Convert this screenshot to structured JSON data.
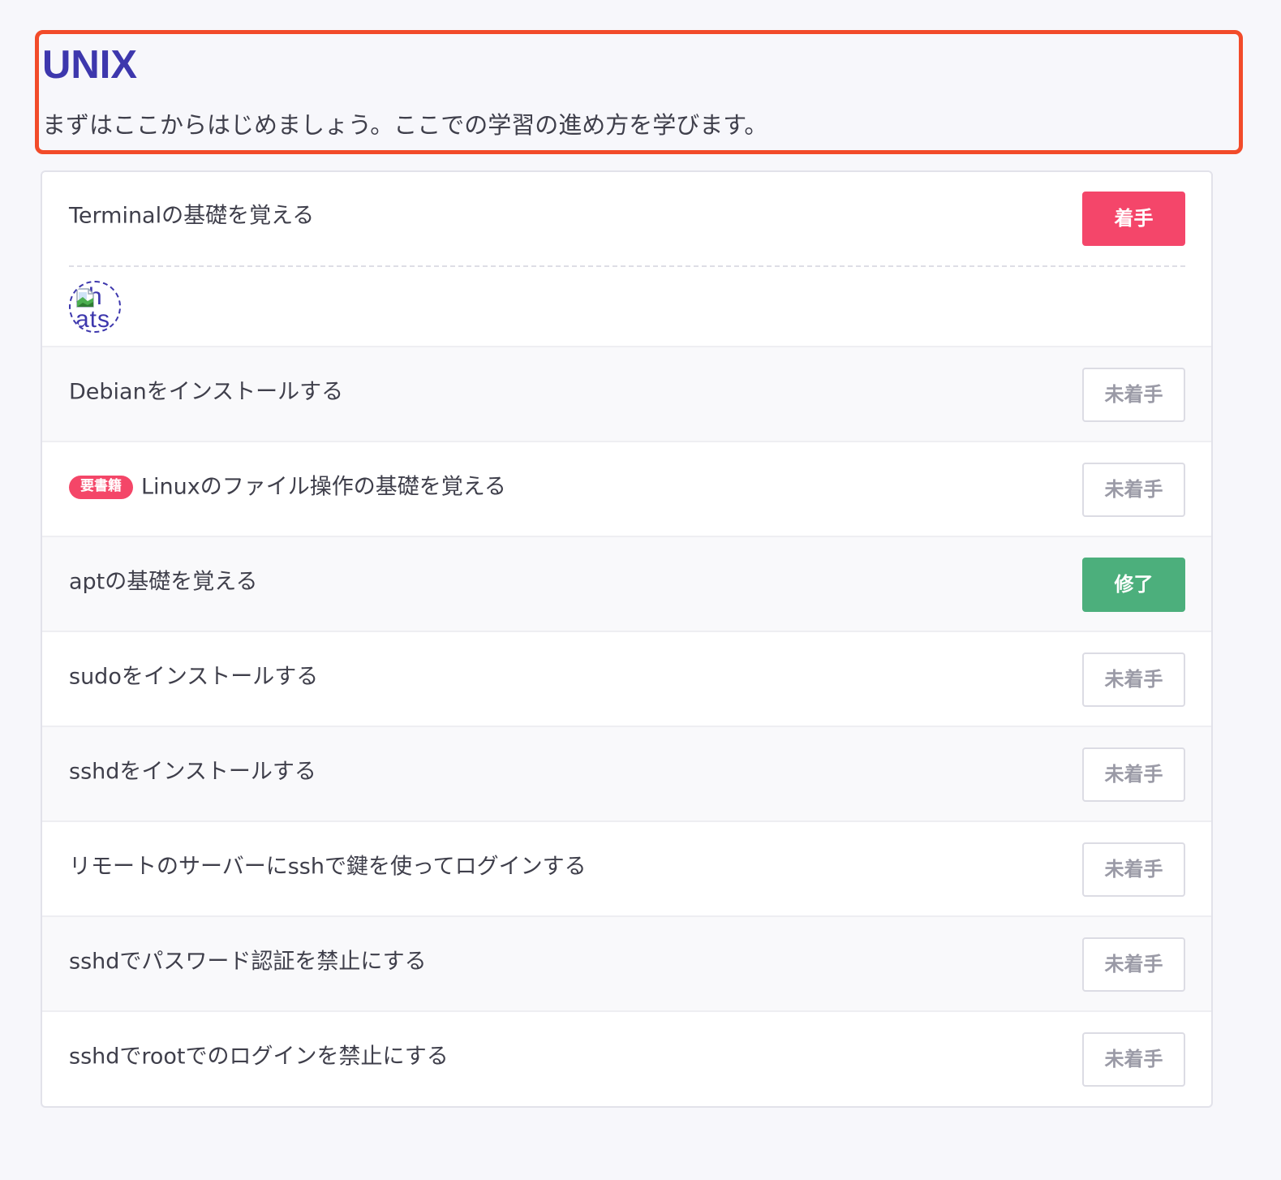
{
  "category": {
    "title": "UNIX",
    "description": "まずはここからはじめましょう。ここでの学習の進め方を学びます。"
  },
  "practices": [
    {
      "title": "Terminalの基礎を覚える",
      "status": "着手",
      "tag": null,
      "learner_avatar_alt": "sh ats"
    },
    {
      "title": "Debianをインストールする",
      "status": "未着手",
      "tag": null
    },
    {
      "title": "Linuxのファイル操作の基礎を覚える",
      "status": "未着手",
      "tag": "要書籍"
    },
    {
      "title": "aptの基礎を覚える",
      "status": "修了",
      "tag": null
    },
    {
      "title": "sudoをインストールする",
      "status": "未着手",
      "tag": null
    },
    {
      "title": "sshdをインストールする",
      "status": "未着手",
      "tag": null
    },
    {
      "title": "リモートのサーバーにsshで鍵を使ってログインする",
      "status": "未着手",
      "tag": null
    },
    {
      "title": "sshdでパスワード認証を禁止にする",
      "status": "未着手",
      "tag": null
    },
    {
      "title": "sshdでrootでのログインを禁止にする",
      "status": "未着手",
      "tag": null
    }
  ],
  "colors": {
    "title": "#3d37ad",
    "highlight_border": "#f24b2a",
    "started": "#f4466a",
    "complete": "#4caf7c",
    "not_started_text": "#9a9aa6"
  },
  "icons": {
    "avatar_placeholder": "broken-image-icon"
  }
}
